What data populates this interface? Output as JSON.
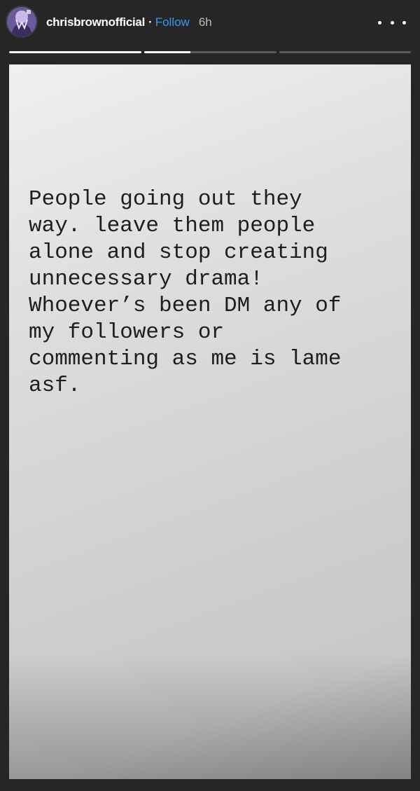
{
  "header": {
    "username": "chrisbrownofficial",
    "separator": "·",
    "follow_label": "Follow",
    "time_ago": "6h",
    "avatar_icon": "profile-avatar",
    "more_icon": "more-options-icon"
  },
  "progress": {
    "segments": [
      {
        "progress": 1.0
      },
      {
        "progress": 0.35
      },
      {
        "progress": 0.0
      }
    ]
  },
  "story": {
    "lines": [
      "People going out they",
      "way. leave them people",
      "alone and stop creating",
      "unnecessary drama!",
      "Whoever’s been DM any of",
      "my followers or",
      "commenting as me is lame",
      "asf."
    ],
    "background_colors": [
      "#f0f0f0",
      "#c8c8c8"
    ]
  },
  "colors": {
    "background": "#262626",
    "link": "#3897f0",
    "progress_track": "#5a5a5a",
    "progress_fill": "#f2f2f2"
  }
}
